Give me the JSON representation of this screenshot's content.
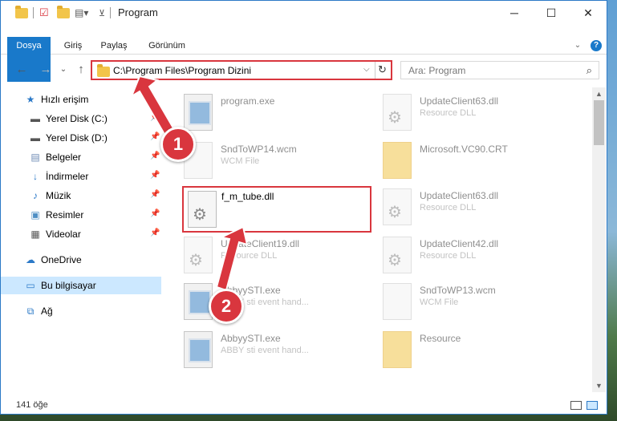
{
  "window": {
    "title": "Program",
    "controls": {
      "minimize": "─",
      "maximize": "☐",
      "close": "✕"
    }
  },
  "ribbon": {
    "tabs": [
      "Dosya",
      "Giriş",
      "Paylaş",
      "Görünüm"
    ],
    "expand_icon": "chevron-down-icon",
    "help": "?"
  },
  "address": {
    "path": "C:\\Program Files\\Program Dizini",
    "dropdown": "⌵",
    "refresh": "↻"
  },
  "search": {
    "placeholder": "Ara: Program",
    "icon": "⌕"
  },
  "nav": {
    "items": [
      {
        "label": "Hızlı erişim",
        "icon": "★",
        "color": "#2b79c7"
      },
      {
        "label": "Yerel Disk (C:)",
        "icon": "▬",
        "color": "#555"
      },
      {
        "label": "Yerel Disk (D:)",
        "icon": "▬",
        "color": "#555"
      },
      {
        "label": "Belgeler",
        "icon": "▤",
        "color": "#6e8bb4"
      },
      {
        "label": "İndirmeler",
        "icon": "↓",
        "color": "#2b79c7"
      },
      {
        "label": "Müzik",
        "icon": "♪",
        "color": "#2b79c7"
      },
      {
        "label": "Resimler",
        "icon": "▣",
        "color": "#4f8fc4"
      },
      {
        "label": "Videolar",
        "icon": "▦",
        "color": "#555"
      },
      {
        "label": "OneDrive",
        "icon": "☁",
        "color": "#2b79c7"
      },
      {
        "label": "Bu bilgisayar",
        "icon": "▭",
        "color": "#2b79c7"
      },
      {
        "label": "Ağ",
        "icon": "⧉",
        "color": "#2b79c7"
      }
    ]
  },
  "files": {
    "left": [
      {
        "name": "program.exe",
        "type": ""
      },
      {
        "name": "SndToWP14.wcm",
        "type": "WCM File"
      },
      {
        "name": "UpdateClient19.dll",
        "type": "Resource DLL"
      },
      {
        "name": "AbbyySTI.exe",
        "type": "ABBY sti event hand..."
      },
      {
        "name": "AbbyySTI.exe",
        "type": "ABBY sti event hand..."
      }
    ],
    "right": [
      {
        "name": "UpdateClient63.dll",
        "type": "Resource DLL"
      },
      {
        "name": "Microsoft.VC90.CRT",
        "type": ""
      },
      {
        "name": "UpdateClient63.dll",
        "type": "Resource DLL"
      },
      {
        "name": "UpdateClient42.dll",
        "type": "Resource DLL"
      },
      {
        "name": "SndToWP13.wcm",
        "type": "WCM File"
      },
      {
        "name": "Resource",
        "type": ""
      }
    ],
    "highlighted": {
      "name": "f_m_tube.dll"
    }
  },
  "status": {
    "count": "141 öğe"
  },
  "annotations": {
    "step1": "1",
    "step2": "2"
  },
  "colors": {
    "accent": "#1979ca",
    "highlight": "#d9363e",
    "selected": "#cce8ff"
  }
}
